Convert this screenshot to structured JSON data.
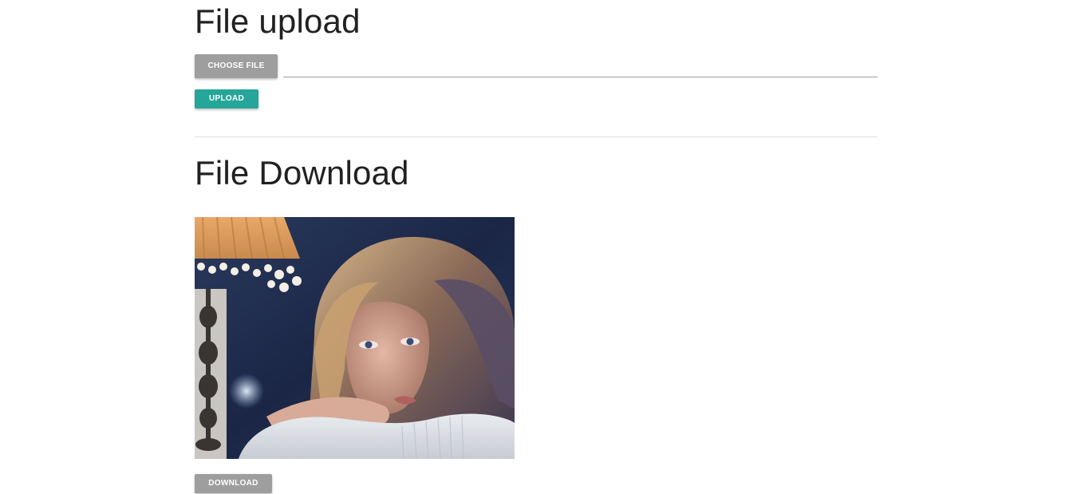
{
  "upload": {
    "title": "File upload",
    "choose_file_label": "CHOOSE FILE",
    "file_path_value": "",
    "upload_label": "UPLOAD"
  },
  "download": {
    "title": "File Download",
    "image_subject": "portrait of a woman with long hair resting her chin on her arms beside a lamp",
    "download_label": "DOWNLOAD"
  },
  "colors": {
    "grey_button": "#9e9e9e",
    "teal_button": "#26a69a",
    "text": "#212121",
    "divider": "#e0e0e0"
  }
}
